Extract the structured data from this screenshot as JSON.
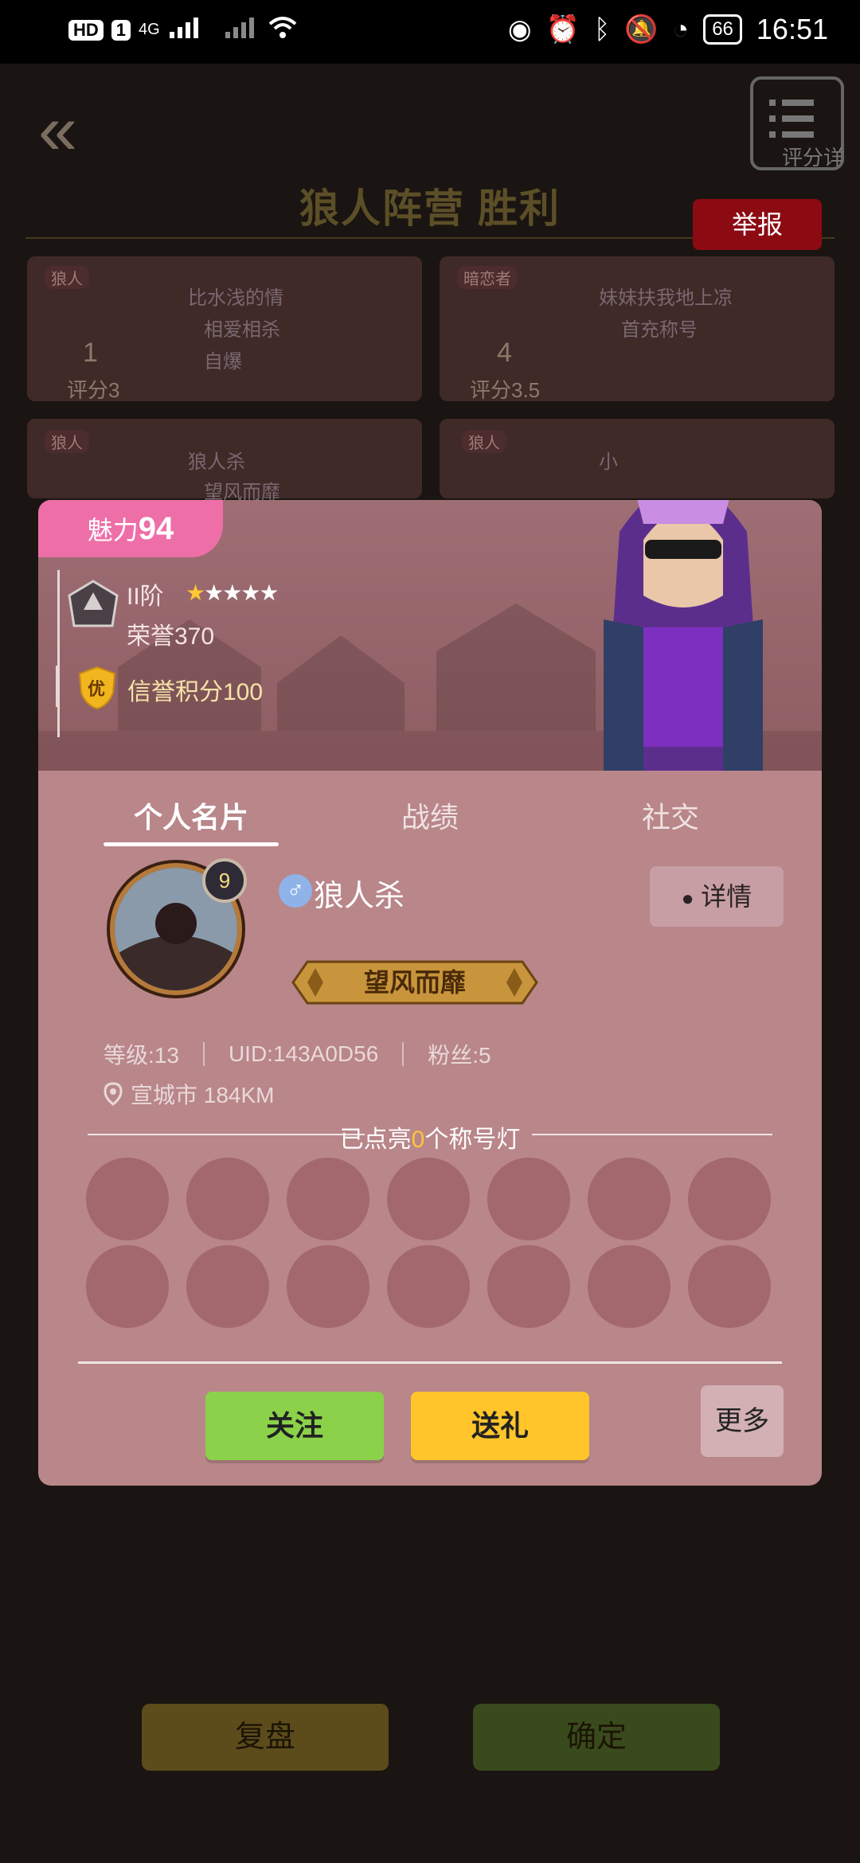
{
  "status_bar": {
    "hd": "HD",
    "sim": "1",
    "network": "4G",
    "battery": "66",
    "time": "16:51"
  },
  "header": {
    "result_title": "狼人阵营 胜利",
    "report_label": "举报",
    "rate_detail_label": "评分详"
  },
  "background_cards": [
    {
      "role": "狼人",
      "name": "比水浅的情",
      "tag": "相爱相杀",
      "seat": "1",
      "score": "评分3",
      "extra": "自爆"
    },
    {
      "role": "暗恋者",
      "name": "妹妹扶我地上凉",
      "tag": "首充称号",
      "seat": "4",
      "score": "评分3.5"
    },
    {
      "role": "狼人",
      "name": "狼人杀",
      "tag": "望风而靡"
    },
    {
      "role": "狼人",
      "name": "小"
    }
  ],
  "bottom_buttons": {
    "replay": "复盘",
    "confirm": "确定"
  },
  "dialog": {
    "charm_label": "魅力",
    "charm_value": "94",
    "rank_level": "II阶",
    "honor": "荣誉370",
    "credit_badge": "优",
    "credit": "信誉积分100",
    "tabs": [
      "个人名片",
      "战绩",
      "社交"
    ],
    "level_badge": "9",
    "nickname": "狼人杀",
    "detail_label": "详情",
    "title_badge": "望风而靡",
    "stats": {
      "level": "等级:13",
      "uid": "UID:143A0D56",
      "fans": "粉丝:5"
    },
    "location": "宣城市  184KM",
    "lamp_prefix": "已点亮",
    "lamp_count": "0",
    "lamp_suffix": "个称号灯",
    "follow_label": "关注",
    "gift_label": "送礼",
    "more_label": "更多"
  },
  "colors": {
    "follow": "#8bd14a",
    "gift": "#ffc52b",
    "charm": "#ee6fa8",
    "report": "#8c0a12"
  }
}
